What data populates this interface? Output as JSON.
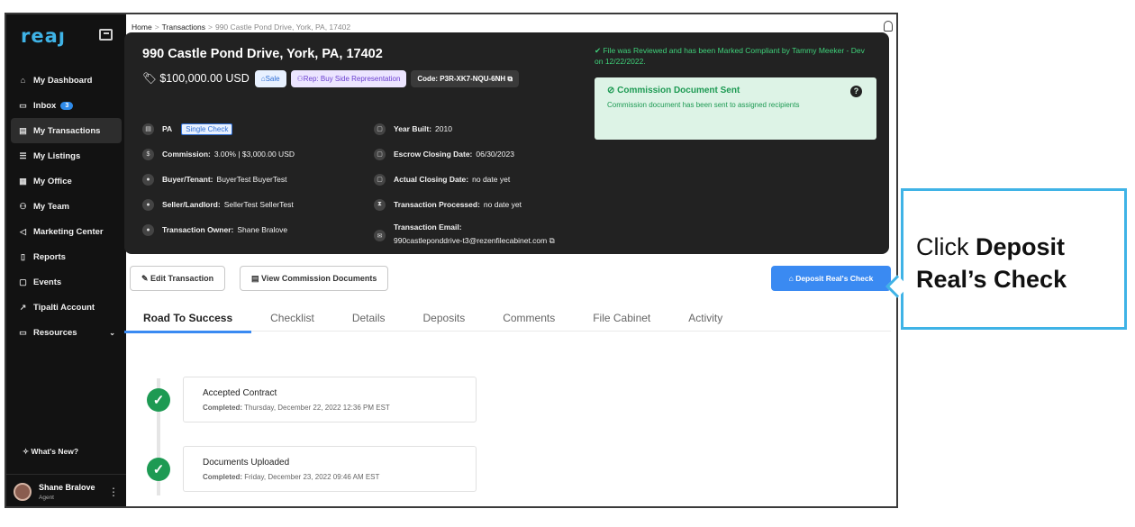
{
  "sidebar": {
    "logo": "reaȷ",
    "items": [
      {
        "label": "My Dashboard",
        "icon": "home-icon",
        "glyph": "⌂"
      },
      {
        "label": "Inbox",
        "icon": "inbox-icon",
        "glyph": "▭",
        "badge": "3"
      },
      {
        "label": "My Transactions",
        "icon": "transactions-icon",
        "glyph": "▤"
      },
      {
        "label": "My Listings",
        "icon": "list-icon",
        "glyph": "☰"
      },
      {
        "label": "My Office",
        "icon": "office-icon",
        "glyph": "▦"
      },
      {
        "label": "My Team",
        "icon": "team-icon",
        "glyph": "⚇"
      },
      {
        "label": "Marketing Center",
        "icon": "megaphone-icon",
        "glyph": "◁"
      },
      {
        "label": "Reports",
        "icon": "reports-icon",
        "glyph": "▯"
      },
      {
        "label": "Events",
        "icon": "calendar-icon",
        "glyph": "▢"
      },
      {
        "label": "Tipalti Account",
        "icon": "external-link-icon",
        "glyph": "↗"
      },
      {
        "label": "Resources",
        "icon": "resources-icon",
        "glyph": "▭"
      }
    ],
    "whats_new": "What's New?",
    "user": {
      "name": "Shane Bralove",
      "role": "Agent"
    }
  },
  "breadcrumb": {
    "home": "Home",
    "transactions": "Transactions",
    "current": "990 Castle Pond Drive, York, PA, 17402"
  },
  "header": {
    "title": "990 Castle Pond Drive, York, PA, 17402",
    "price": "$100,000.00 USD",
    "sale_chip": "Sale",
    "rep_chip": "Rep: Buy Side Representation",
    "code_chip": "Code: P3R-XK7-NQU-6NH",
    "state": "PA",
    "check_chip": "Single Check",
    "commission_label": "Commission:",
    "commission_value": "3.00% | $3,000.00 USD",
    "buyer_label": "Buyer/Tenant:",
    "buyer_value": "BuyerTest BuyerTest",
    "seller_label": "Seller/Landlord:",
    "seller_value": "SellerTest SellerTest",
    "owner_label": "Transaction Owner:",
    "owner_value": "Shane Bralove",
    "year_label": "Year Built:",
    "year_value": "2010",
    "escrow_label": "Escrow Closing Date:",
    "escrow_value": "06/30/2023",
    "actual_label": "Actual Closing Date:",
    "actual_value": "no date yet",
    "processed_label": "Transaction Processed:",
    "processed_value": "no date yet",
    "email_label": "Transaction Email:",
    "email_value": "990castleponddrive-t3@rezenfilecabinet.com",
    "reviewed": "File was Reviewed and has been Marked Compliant by Tammy Meeker - Dev on 12/22/2022.",
    "commission_box_title": "Commission Document Sent",
    "commission_box_text": "Commission document has been sent to assigned recipients"
  },
  "actions": {
    "edit": "Edit Transaction",
    "view_docs": "View Commission Documents",
    "deposit": "Deposit Real's Check"
  },
  "tabs": [
    "Road To Success",
    "Checklist",
    "Details",
    "Deposits",
    "Comments",
    "File Cabinet",
    "Activity"
  ],
  "timeline": [
    {
      "title": "Accepted Contract",
      "completed_label": "Completed:",
      "completed_value": "Thursday, December 22, 2022 12:36 PM EST"
    },
    {
      "title": "Documents Uploaded",
      "completed_label": "Completed:",
      "completed_value": "Friday, December 23, 2022 09:46 AM EST"
    }
  ],
  "callout": {
    "prefix": "Click ",
    "bold1": "Deposit",
    "bold2": "Real’s Check"
  },
  "colors": {
    "accent": "#3a8af2",
    "success": "#1d9a53",
    "callout_border": "#3fb3e6",
    "sidebar_bg": "#121212",
    "card_bg": "#222222"
  }
}
